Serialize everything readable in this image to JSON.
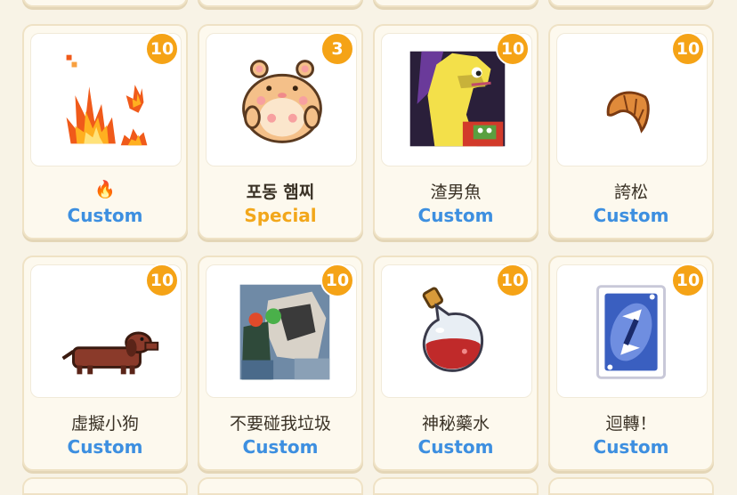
{
  "colors": {
    "custom": "#3d8fe0",
    "special": "#f2a71b",
    "badge": "#f5a316"
  },
  "cards": [
    {
      "badge": "10",
      "name": "🔥",
      "category": "Custom",
      "category_type": "custom",
      "icon": "fire-icon",
      "name_bold": false
    },
    {
      "badge": "3",
      "name": "포동 햄찌",
      "category": "Special",
      "category_type": "special",
      "icon": "hamster-icon",
      "name_bold": true
    },
    {
      "badge": "10",
      "name": "渣男魚",
      "category": "Custom",
      "category_type": "custom",
      "icon": "yellow-fish-icon",
      "name_bold": false
    },
    {
      "badge": "10",
      "name": "誇松",
      "category": "Custom",
      "category_type": "custom",
      "icon": "croissant-icon",
      "name_bold": false
    },
    {
      "badge": "10",
      "name": "虛擬小狗",
      "category": "Custom",
      "category_type": "custom",
      "icon": "dachshund-icon",
      "name_bold": false
    },
    {
      "badge": "10",
      "name": "不要碰我垃圾",
      "category": "Custom",
      "category_type": "custom",
      "icon": "trash-pile-icon",
      "name_bold": false
    },
    {
      "badge": "10",
      "name": "神秘藥水",
      "category": "Custom",
      "category_type": "custom",
      "icon": "potion-icon",
      "name_bold": false
    },
    {
      "badge": "10",
      "name": "迴轉！",
      "category": "Custom",
      "category_type": "custom",
      "icon": "reverse-card-icon",
      "name_bold": false
    }
  ]
}
